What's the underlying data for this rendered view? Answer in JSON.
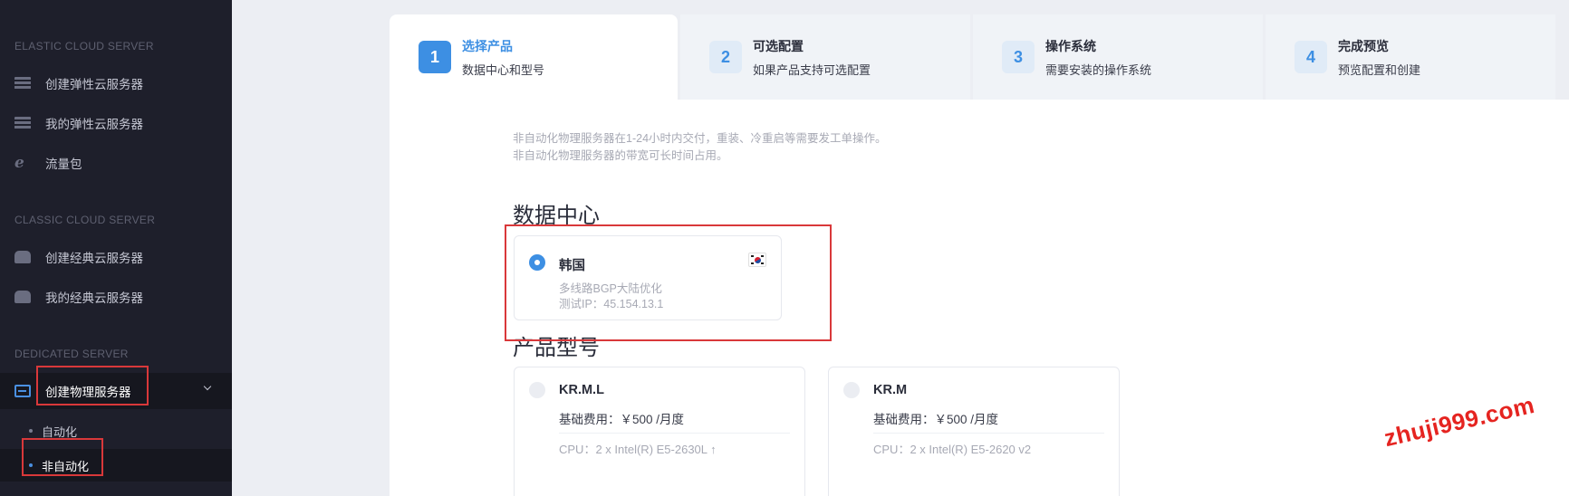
{
  "sidebar": {
    "sections": [
      {
        "title": "ELASTIC CLOUD SERVER",
        "items": [
          {
            "label": "创建弹性云服务器",
            "icon": "server-icon"
          },
          {
            "label": "我的弹性云服务器",
            "icon": "server-icon"
          },
          {
            "label": "流量包",
            "icon": "traffic-icon"
          }
        ]
      },
      {
        "title": "CLASSIC CLOUD SERVER",
        "items": [
          {
            "label": "创建经典云服务器",
            "icon": "disk-icon"
          },
          {
            "label": "我的经典云服务器",
            "icon": "disk-icon"
          }
        ]
      },
      {
        "title": "DEDICATED SERVER",
        "items": [
          {
            "label": "创建物理服务器",
            "icon": "card-icon",
            "expanded": true
          }
        ]
      }
    ],
    "sub_items": [
      {
        "label": "自动化"
      },
      {
        "label": "非自动化",
        "active": true
      }
    ]
  },
  "steps": [
    {
      "num": "1",
      "title": "选择产品",
      "sub": "数据中心和型号",
      "active": true
    },
    {
      "num": "2",
      "title": "可选配置",
      "sub": "如果产品支持可选配置"
    },
    {
      "num": "3",
      "title": "操作系统",
      "sub": "需要安装的操作系统"
    },
    {
      "num": "4",
      "title": "完成预览",
      "sub": "预览配置和创建"
    }
  ],
  "notice": [
    "非自动化物理服务器在1-24小时内交付，重装、冷重启等需要发工单操作。",
    "非自动化物理服务器的带宽可长时间占用。"
  ],
  "datacenter": {
    "heading": "数据中心",
    "cards": [
      {
        "name": "韩国",
        "line1": "多线路BGP大陆优化",
        "line2": "测试IP：45.154.13.1",
        "selected": true,
        "flag": "korea-flag-icon"
      }
    ]
  },
  "products": {
    "heading": "产品型号",
    "cards": [
      {
        "name": "KR.M.L",
        "price": "基础费用：￥500 /月度",
        "cpu": "CPU：2 x Intel(R) E5-2630L",
        "cpu_tail": "↑"
      },
      {
        "name": "KR.M",
        "price": "基础费用：￥500 /月度",
        "cpu": "CPU：2 x Intel(R) E5-2620 v2",
        "cpu_tail": ""
      }
    ]
  },
  "watermark": "zhuji999.com",
  "colors": {
    "accent": "#3d8fe3",
    "sidebar_bg": "#1e1f2b",
    "highlight": "#d9383a"
  }
}
